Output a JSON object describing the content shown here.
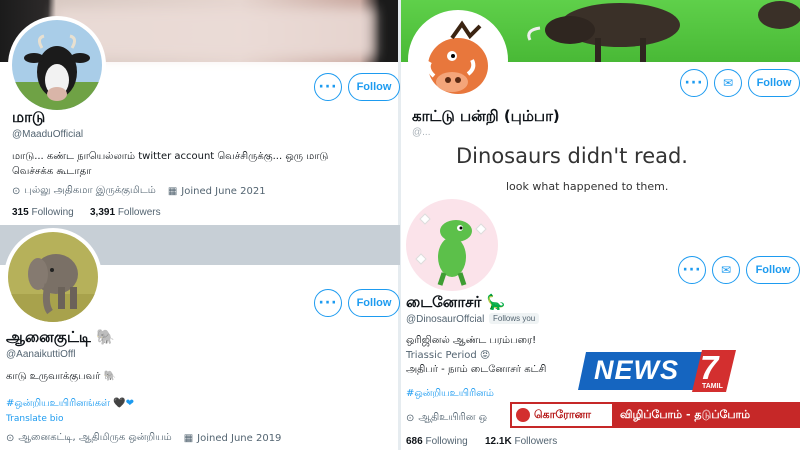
{
  "profiles": [
    {
      "name": "மாடு",
      "handle": "@MaaduOfficial",
      "bio": "மாடு... கண்ட நாயெல்லாம் twitter account வெச்சிருக்கு... ஒரு மாடு வெச்சக்க கூடாதா",
      "location": "புல்லு அதிகமா இருக்குமிடம்",
      "joined": "Joined June 2021",
      "following_count": "315",
      "following_label": "Following",
      "followers_count": "3,391",
      "followers_label": "Followers",
      "follow_label": "Follow"
    },
    {
      "name": "காட்டு பன்றி (பும்பா)",
      "handle": "@...",
      "follow_label": "Follow"
    },
    {
      "name": "ஆனைகுட்டி 🐘",
      "handle": "@AanaikuttiOffl",
      "bio": "காடு உருவாக்குபவர் 🐘",
      "hashtag": "#ஒன்றியஉயிரினங்கள் 🖤❤",
      "translate": "Translate bio",
      "location": "ஆனைகட்டி, ஆதிமிருக ஒன்றியம்",
      "joined": "Joined June 2019",
      "follow_label": "Follow"
    },
    {
      "name": "டைனோசர் 🦕",
      "handle": "@DinosaurOffcial",
      "follows_you": "Follows you",
      "bio1": "ஒரிஜினல் ஆண்ட பரம்பரை!",
      "bio2": "Triassic Period 😡",
      "bio3": "அதிபர் - நாம் டைனோசர் கட்சி",
      "hashtag": "#ஒன்றியஉயிரினம்",
      "location": "ஆதிஉயிரின ஒ",
      "following_count": "686",
      "following_label": "Following",
      "followers_count": "12.1K",
      "followers_label": "Followers",
      "follow_label": "Follow"
    }
  ],
  "dino_banner": {
    "line1": "Dinosaurs didn't read.",
    "line2": "look what happened to them."
  },
  "news": {
    "logo": "NEWS",
    "logo_num": "7",
    "logo_sub": "TAMIL",
    "ticker_left": "கொரோனா",
    "ticker_right": "விழிப்போம் - தடுப்போம்"
  },
  "colors": {
    "accent": "#1d9bf0",
    "news_blue": "#1565c0",
    "news_red": "#d32f2f"
  }
}
